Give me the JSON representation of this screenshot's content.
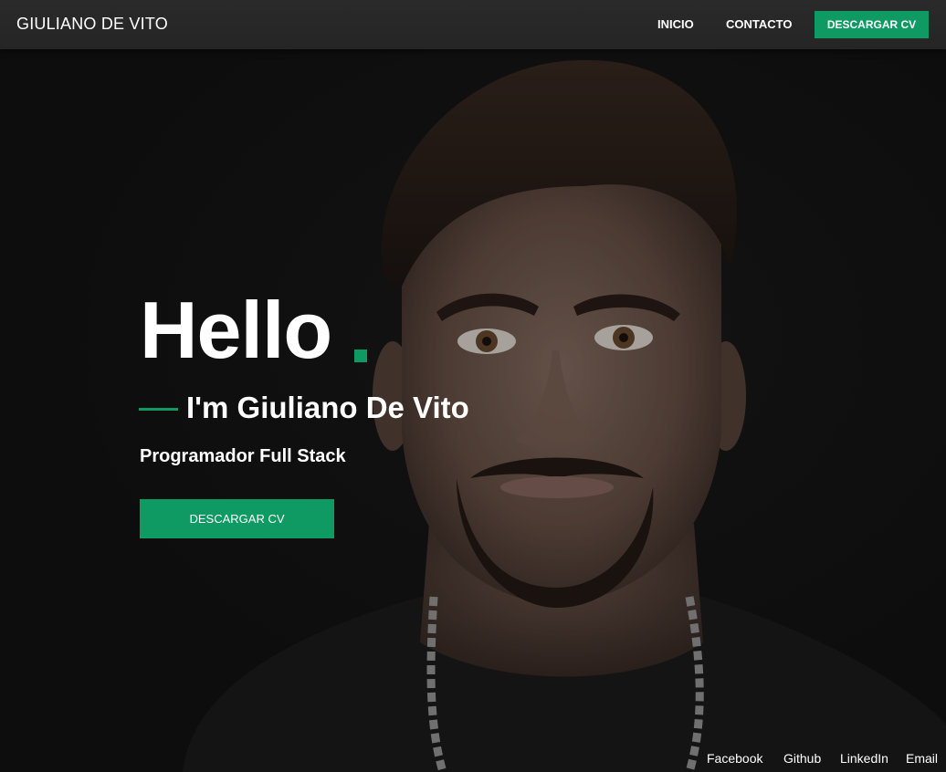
{
  "navbar": {
    "brand": "GIULIANO DE VITO",
    "links": [
      "INICIO",
      "CONTACTO"
    ],
    "cv_button": "DESCARGAR CV"
  },
  "hero": {
    "title": "Hello",
    "name": "I'm Giuliano De Vito",
    "role": "Programador Full Stack",
    "cv_button": "DESCARGAR CV"
  },
  "social": [
    "Facebook",
    "Github",
    "LinkedIn",
    "Email"
  ],
  "colors": {
    "accent": "#0f9a63",
    "background": "#131313",
    "navbar": "#262626",
    "text": "#ffffff"
  },
  "icons": []
}
